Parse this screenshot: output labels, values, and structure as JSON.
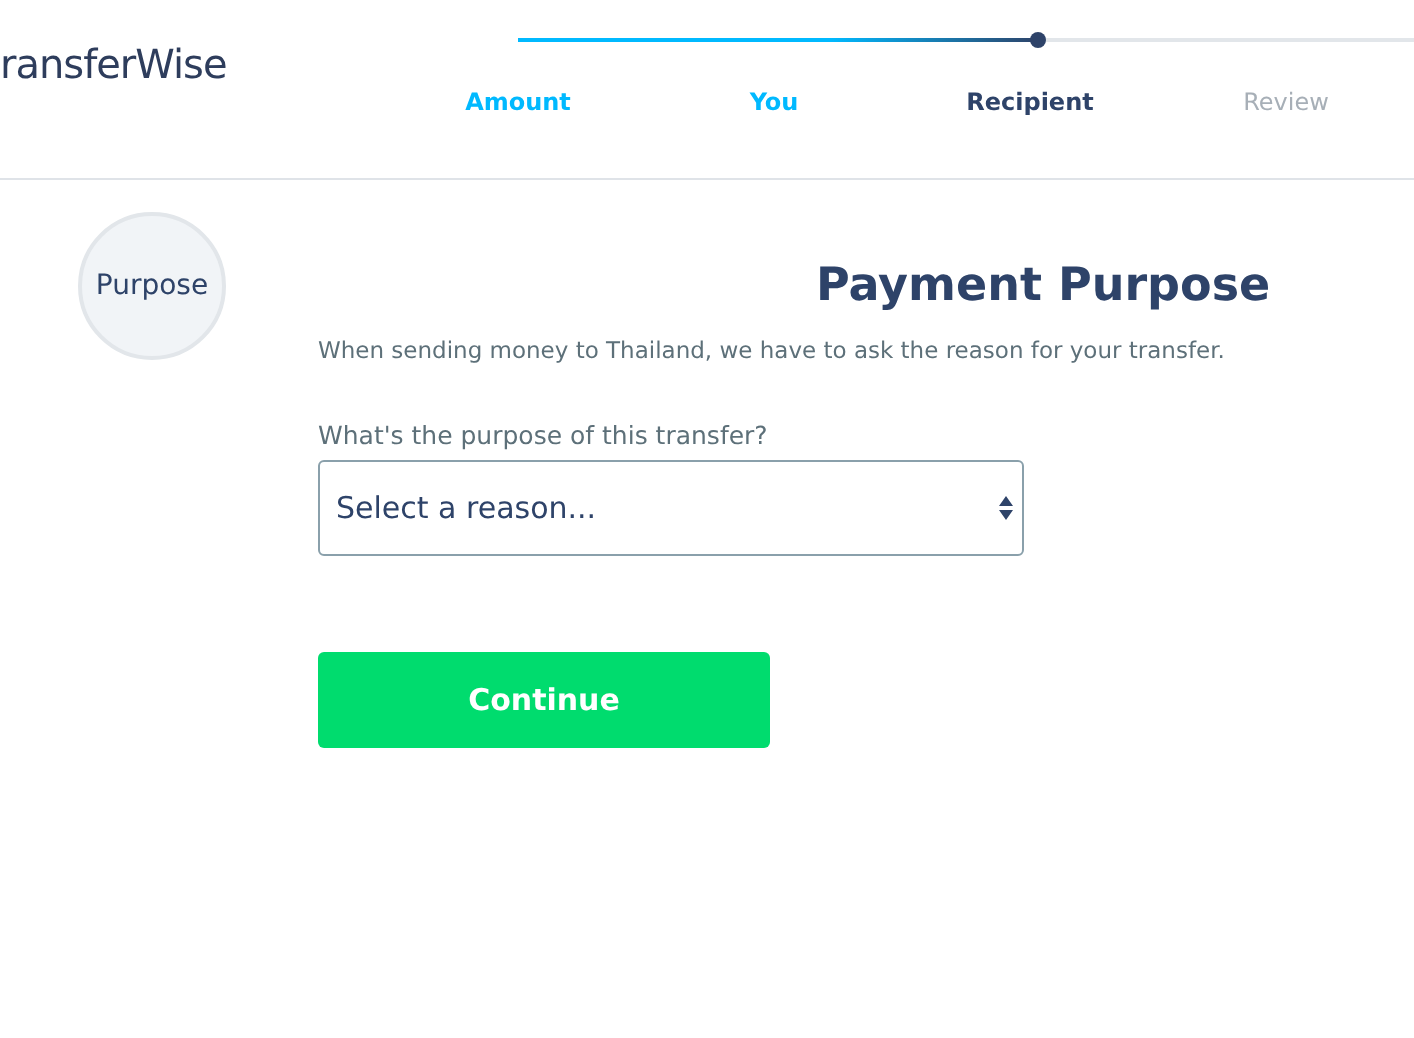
{
  "header": {
    "logo": "ransferWise"
  },
  "progress": {
    "level": 0.58
  },
  "steps": [
    {
      "label": "Amount",
      "kind": "done"
    },
    {
      "label": "You",
      "kind": "done"
    },
    {
      "label": "Recipient",
      "kind": "current"
    },
    {
      "label": "Review",
      "kind": "upcoming"
    }
  ],
  "section_badge": "Purpose",
  "title": "Payment Purpose",
  "description": "When sending money to Thailand, we have to ask the reason for your transfer.",
  "form": {
    "label": "What's the purpose of this transfer?",
    "placeholder": "Select a reason..."
  },
  "button": "Continue"
}
